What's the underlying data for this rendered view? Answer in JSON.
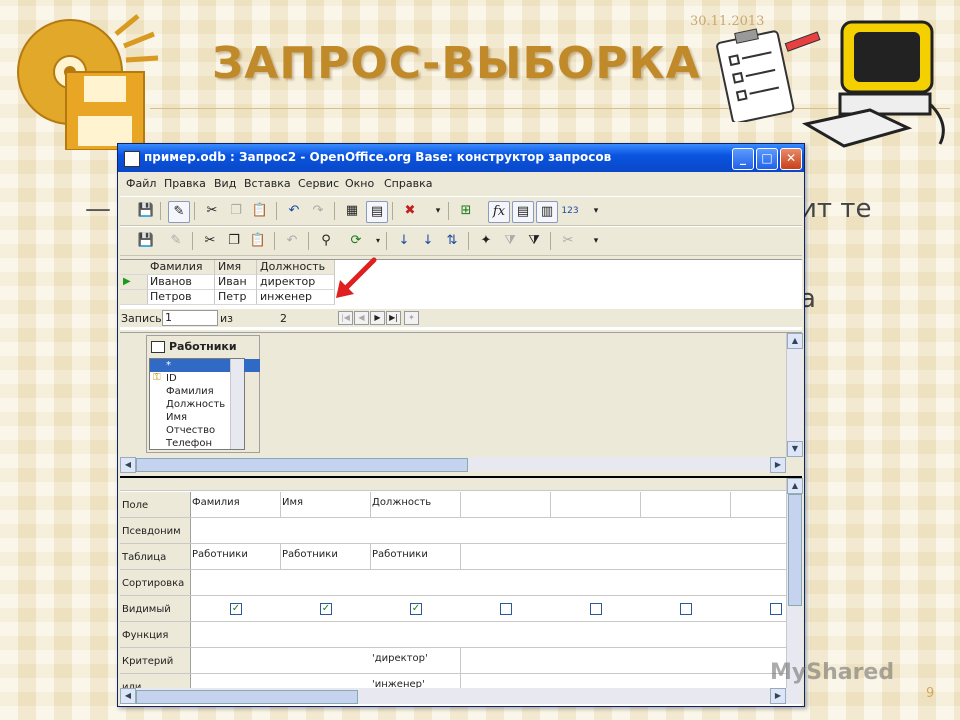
{
  "slide": {
    "date": "30.11.2013",
    "title": "ЗАПРОС-ВЫБОРКА",
    "bullet_visible": "—",
    "behind_text_1": "ит те",
    "behind_text_2": "а",
    "page_number": "9",
    "watermark": "MyShared"
  },
  "window": {
    "title": "пример.odb : Запрос2 - OpenOffice.org Base: конструктор запросов",
    "controls": {
      "minimize": "_",
      "maximize": "□",
      "close": "✕"
    }
  },
  "menu": [
    "Файл",
    "Правка",
    "Вид",
    "Вставка",
    "Сервис",
    "Окно",
    "Справка"
  ],
  "data_grid": {
    "columns": [
      "Фамилия",
      "Имя",
      "Должность"
    ],
    "rows": [
      [
        "Иванов",
        "Иван",
        "директор"
      ],
      [
        "Петров",
        "Петр",
        "инженер"
      ]
    ],
    "record_label": "Запись",
    "record_current": "1",
    "record_of": "из",
    "record_total": "2"
  },
  "table_widget": {
    "name": "Работники",
    "fields": [
      "*",
      "ID",
      "Фамилия",
      "Должность",
      "Имя",
      "Отчество",
      "Телефон"
    ]
  },
  "design_grid": {
    "row_labels": [
      "Поле",
      "Псевдоним",
      "Таблица",
      "Сортировка",
      "Видимый",
      "Функция",
      "Критерий",
      "или"
    ],
    "columns": [
      {
        "field": "Фамилия",
        "table": "Работники",
        "visible": true,
        "criterion": "",
        "or": ""
      },
      {
        "field": "Имя",
        "table": "Работники",
        "visible": true,
        "criterion": "",
        "or": ""
      },
      {
        "field": "Должность",
        "table": "Работники",
        "visible": true,
        "criterion": "'директор'",
        "or": "'инженер'"
      },
      {
        "field": "",
        "table": "",
        "visible": false,
        "criterion": "",
        "or": ""
      },
      {
        "field": "",
        "table": "",
        "visible": false,
        "criterion": "",
        "or": ""
      },
      {
        "field": "",
        "table": "",
        "visible": false,
        "criterion": "",
        "or": ""
      },
      {
        "field": "",
        "table": "",
        "visible": false,
        "criterion": "",
        "or": ""
      }
    ]
  },
  "icons": {
    "disk_logo": "cd-floppy-icon",
    "clipboard": "clipboard-checklist-icon",
    "computer": "computer-icon",
    "arrow": "red-arrow-icon"
  },
  "colors": {
    "title": "#c08a2a",
    "title_bar": "#0a54e0",
    "arrow": "#e02020"
  }
}
